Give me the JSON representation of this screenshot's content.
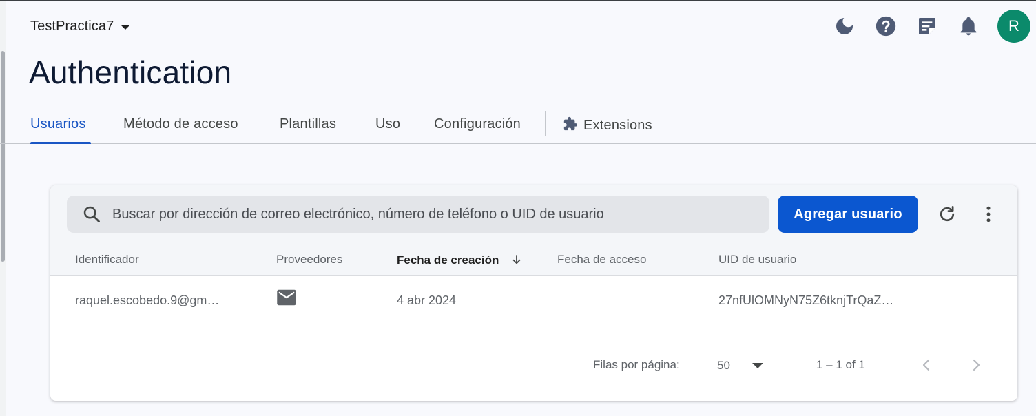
{
  "header": {
    "project_name": "TestPractica7",
    "avatar_initial": "R"
  },
  "page": {
    "title": "Authentication"
  },
  "tabs": [
    {
      "label": "Usuarios",
      "active": true
    },
    {
      "label": "Método de acceso",
      "active": false
    },
    {
      "label": "Plantillas",
      "active": false
    },
    {
      "label": "Uso",
      "active": false
    },
    {
      "label": "Configuración",
      "active": false
    },
    {
      "label": "Extensions",
      "active": false
    }
  ],
  "toolbar": {
    "search_placeholder": "Buscar por dirección de correo electrónico, número de teléfono o UID de usuario",
    "add_user_label": "Agregar usuario"
  },
  "table": {
    "columns": [
      "Identificador",
      "Proveedores",
      "Fecha de creación",
      "Fecha de acceso",
      "UID de usuario"
    ],
    "sorted_column": "Fecha de creación",
    "rows": [
      {
        "identifier": "raquel.escobedo.9@gm…",
        "provider_icon": "email-icon",
        "created": "4 abr 2024",
        "last_signin": "",
        "uid": "27nfUlOMNyN75Z6tknjTrQaZ…"
      }
    ]
  },
  "pagination": {
    "rows_per_page_label": "Filas por página:",
    "rows_per_page_value": "50",
    "range_text": "1 – 1 of 1"
  },
  "colors": {
    "accent": "#0b57d0",
    "active_tab": "#1a56c4",
    "avatar_bg": "#0b8a6b"
  }
}
